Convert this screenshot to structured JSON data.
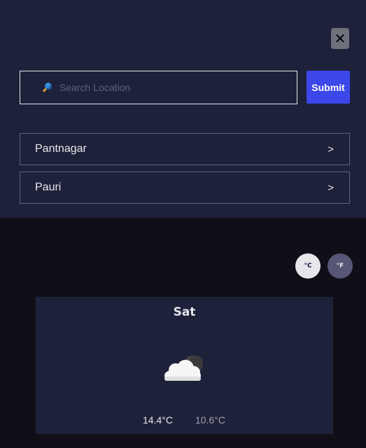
{
  "search": {
    "close_glyph": "✕",
    "placeholder": "Search Location",
    "submit_label": "Submit",
    "icon": "search-icon"
  },
  "locations": [
    {
      "name": "Pantnagar",
      "arrow": ">"
    },
    {
      "name": "Pauri",
      "arrow": ">"
    }
  ],
  "units": {
    "celsius_label": "°C",
    "fahrenheit_label": "°F",
    "selected": "celsius"
  },
  "forecast": [
    {
      "day": "Sat",
      "icon": "cloud-moon-icon",
      "max": "14.4°C",
      "min": "10.6°C"
    }
  ],
  "colors": {
    "panel": "#1e213a",
    "background": "#100e17",
    "accent": "#3c47e9"
  }
}
